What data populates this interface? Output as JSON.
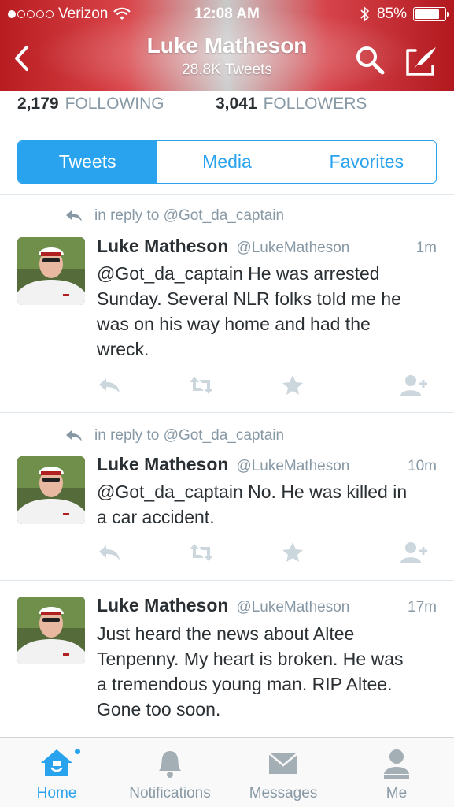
{
  "status_bar": {
    "carrier": "Verizon",
    "time": "12:08 AM",
    "battery": "85%",
    "battery_level": 0.85,
    "signal_bars_filled": 1,
    "signal_bars_total": 5
  },
  "header": {
    "name": "Luke Matheson",
    "tweet_count": "28.8K Tweets"
  },
  "stats": {
    "following_count": "2,179",
    "following_label": "FOLLOWING",
    "followers_count": "3,041",
    "followers_label": "FOLLOWERS"
  },
  "segments": [
    {
      "label": "Tweets",
      "active": true
    },
    {
      "label": "Media",
      "active": false
    },
    {
      "label": "Favorites",
      "active": false
    }
  ],
  "tweets": [
    {
      "reply_to": "in reply to @Got_da_captain",
      "name": "Luke Matheson",
      "handle": "@LukeMatheson",
      "time": "1m",
      "lines": [
        "@Got_da_captain He was arrested",
        "Sunday. Several NLR folks told me he",
        "was on his way home and had the",
        "wreck."
      ]
    },
    {
      "reply_to": "in reply to @Got_da_captain",
      "name": "Luke Matheson",
      "handle": "@LukeMatheson",
      "time": "10m",
      "lines": [
        "@Got_da_captain No. He was killed in",
        "a car accident."
      ]
    },
    {
      "reply_to": "",
      "name": "Luke Matheson",
      "handle": "@LukeMatheson",
      "time": "17m",
      "lines": [
        "Just heard the news about Altee",
        "Tenpenny. My heart is broken. He was",
        "a tremendous young man. RIP Altee.",
        "Gone too soon."
      ]
    }
  ],
  "tabbar": [
    {
      "label": "Home",
      "icon": "home-icon",
      "active": true
    },
    {
      "label": "Notifications",
      "icon": "bell-icon",
      "active": false
    },
    {
      "label": "Messages",
      "icon": "envelope-icon",
      "active": false
    },
    {
      "label": "Me",
      "icon": "person-icon",
      "active": false
    }
  ],
  "colors": {
    "accent": "#2aa3ef",
    "header_red": "#c0272c",
    "muted": "#8899a6",
    "text": "#292f33"
  }
}
